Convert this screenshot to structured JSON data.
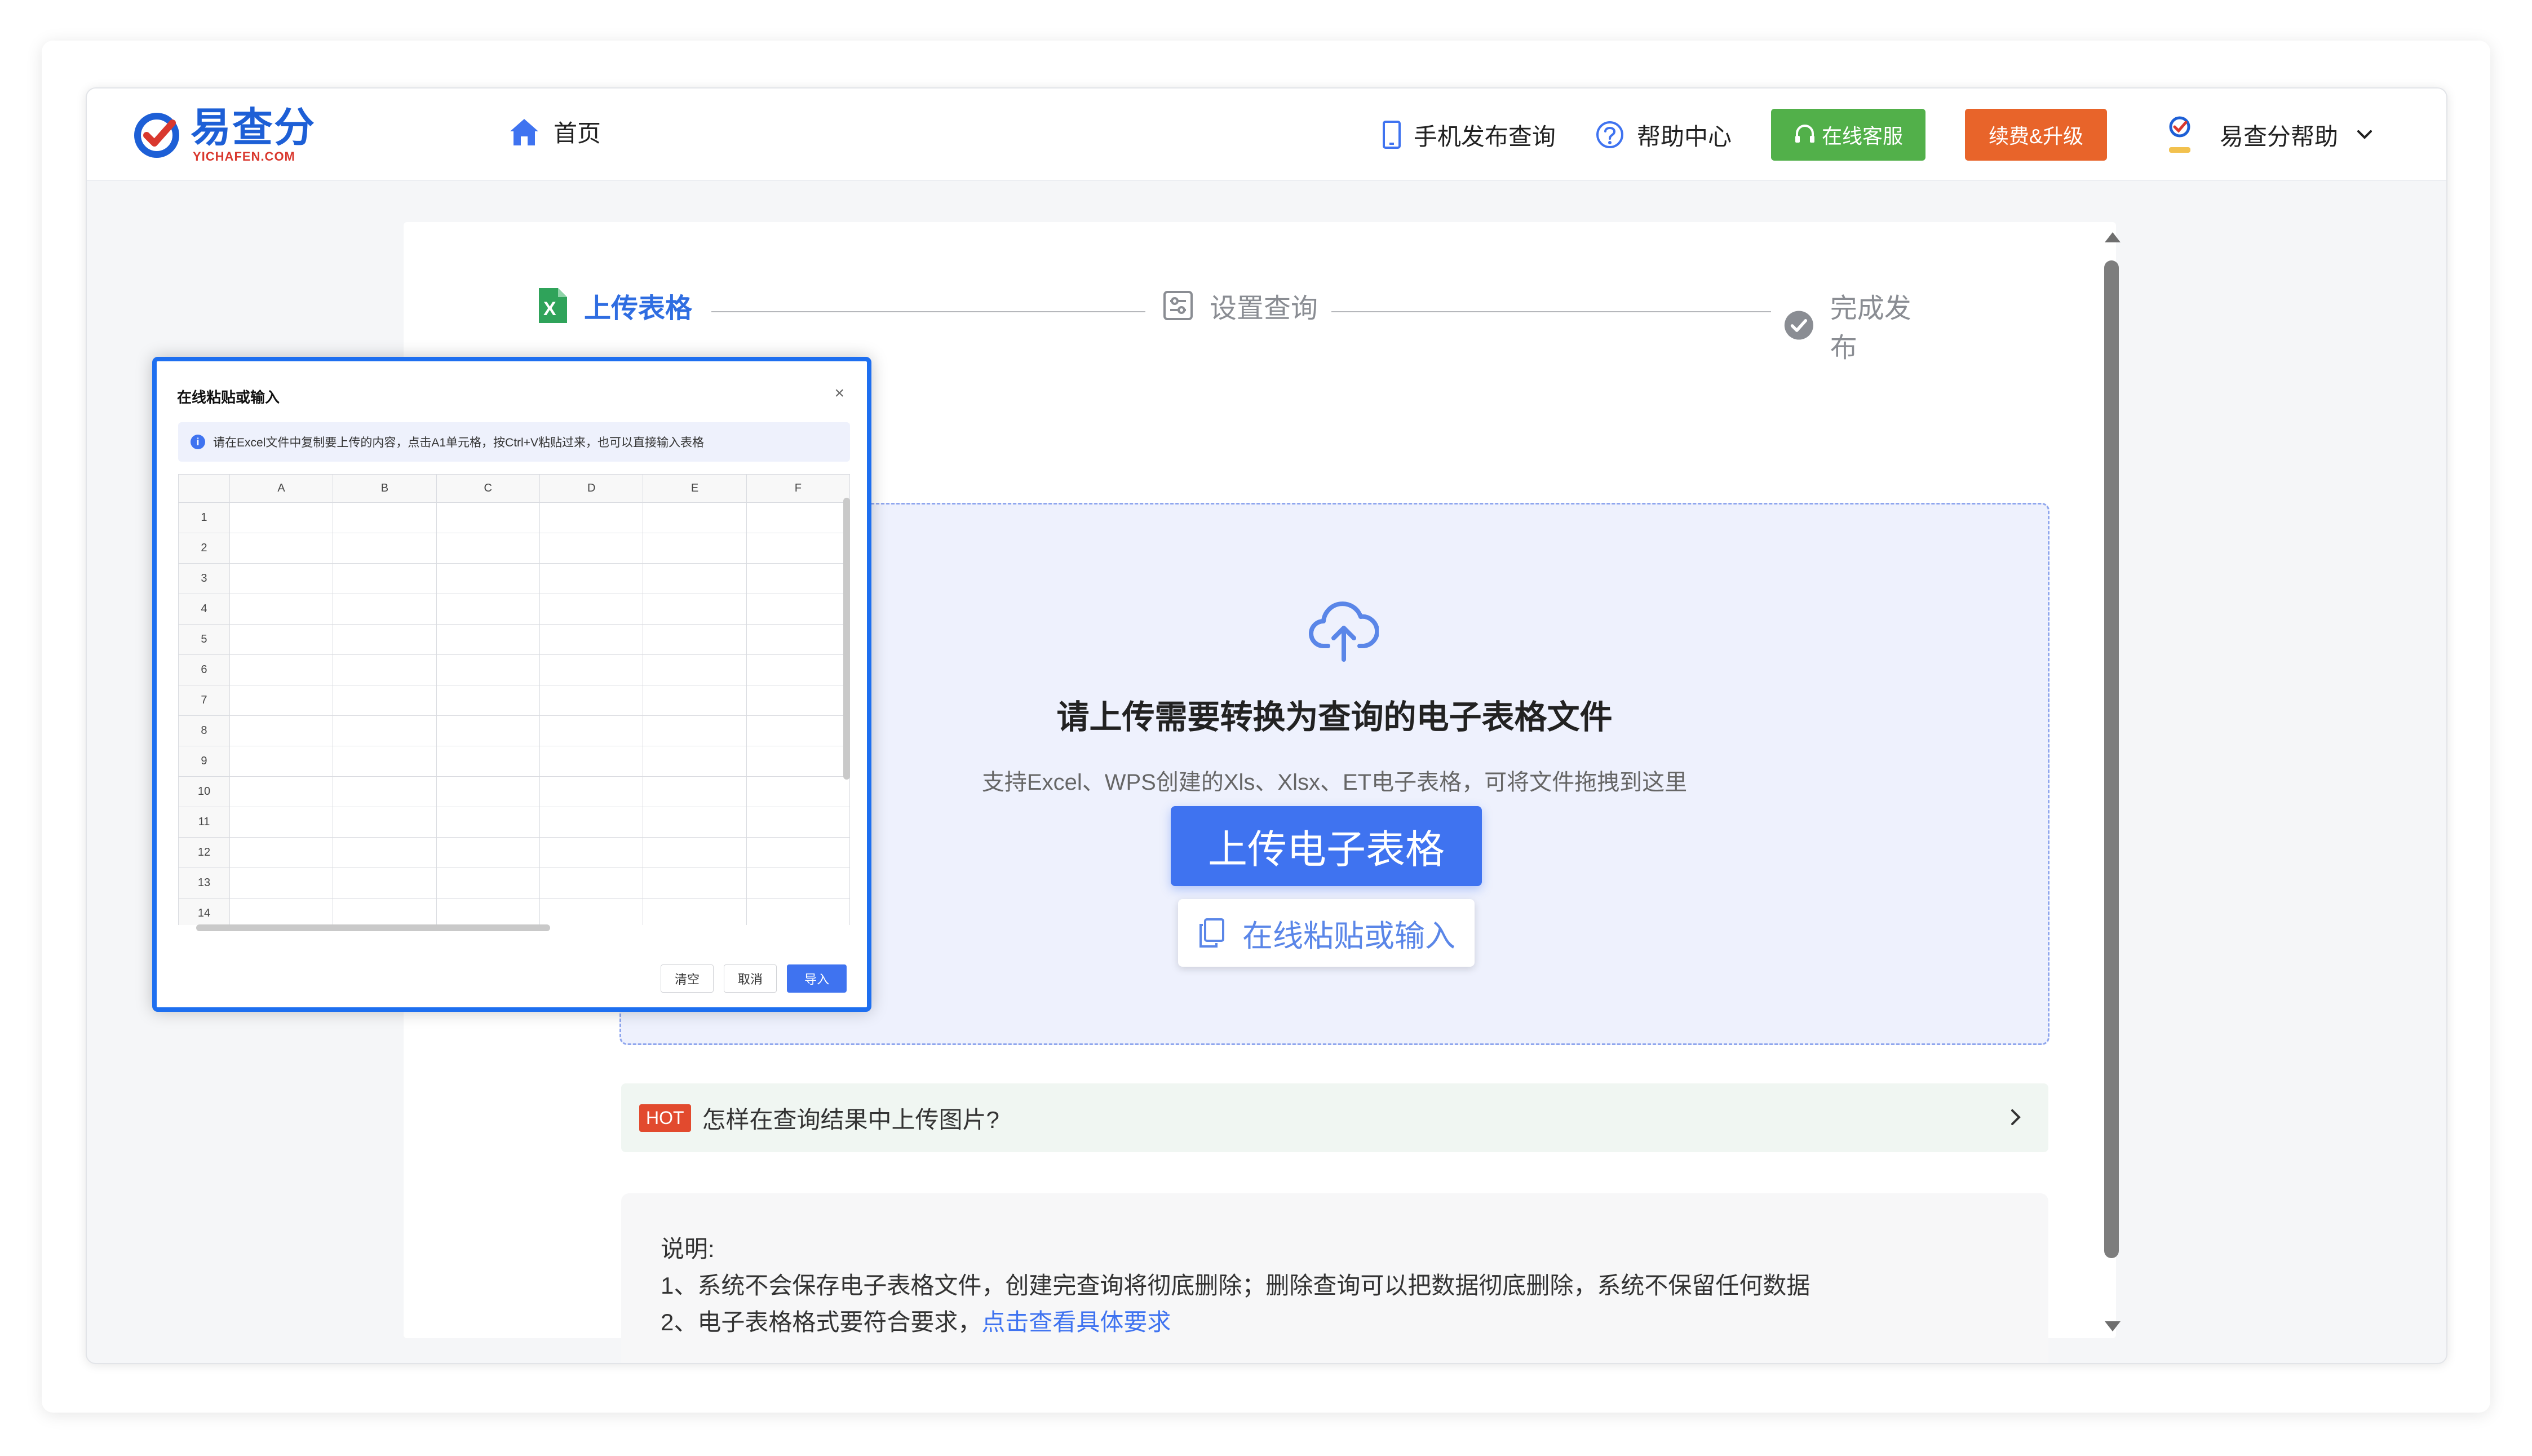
{
  "header": {
    "logo_cn": "易查分",
    "logo_en": "YICHAFEN.COM",
    "home_label": "首页",
    "mobile_label": "手机发布查询",
    "help_label": "帮助中心",
    "service_label": "在线客服",
    "upgrade_label": "续费&升级",
    "user_label": "易查分帮助",
    "avatar_text": "易查分"
  },
  "steps": [
    {
      "label": "上传表格",
      "state": "active"
    },
    {
      "label": "设置查询",
      "state": "inactive"
    },
    {
      "label": "完成发布",
      "state": "inactive"
    }
  ],
  "upload": {
    "title": "请上传需要转换为查询的电子表格文件",
    "subtitle": "支持Excel、WPS创建的Xls、Xlsx、ET电子表格，可将文件拖拽到这里",
    "upload_button": "上传电子表格",
    "paste_button": "在线粘贴或输入"
  },
  "hot": {
    "badge": "HOT",
    "text": "怎样在查询结果中上传图片?"
  },
  "note": {
    "title": "说明:",
    "line1": "1、系统不会保存电子表格文件，创建完查询将彻底删除；删除查询可以把数据彻底删除，系统不保留任何数据",
    "line2_prefix": "2、电子表格格式要符合要求，",
    "line2_link": "点击查看具体要求"
  },
  "dialog": {
    "title": "在线粘贴或输入",
    "close": "×",
    "info_icon": "i",
    "info": "请在Excel文件中复制要上传的内容，点击A1单元格，按Ctrl+V粘贴过来，也可以直接输入表格",
    "columns": [
      "A",
      "B",
      "C",
      "D",
      "E",
      "F"
    ],
    "rows": [
      "1",
      "2",
      "3",
      "4",
      "5",
      "6",
      "7",
      "8",
      "9",
      "10",
      "11",
      "12",
      "13",
      "14"
    ],
    "btn_clear": "清空",
    "btn_cancel": "取消",
    "btn_import": "导入"
  },
  "colors": {
    "accent": "#3f73f0",
    "service_green": "#52b04a",
    "upgrade_orange": "#e8642a",
    "hot_red": "#e24a2e",
    "dialog_border": "#1e6ff0"
  }
}
